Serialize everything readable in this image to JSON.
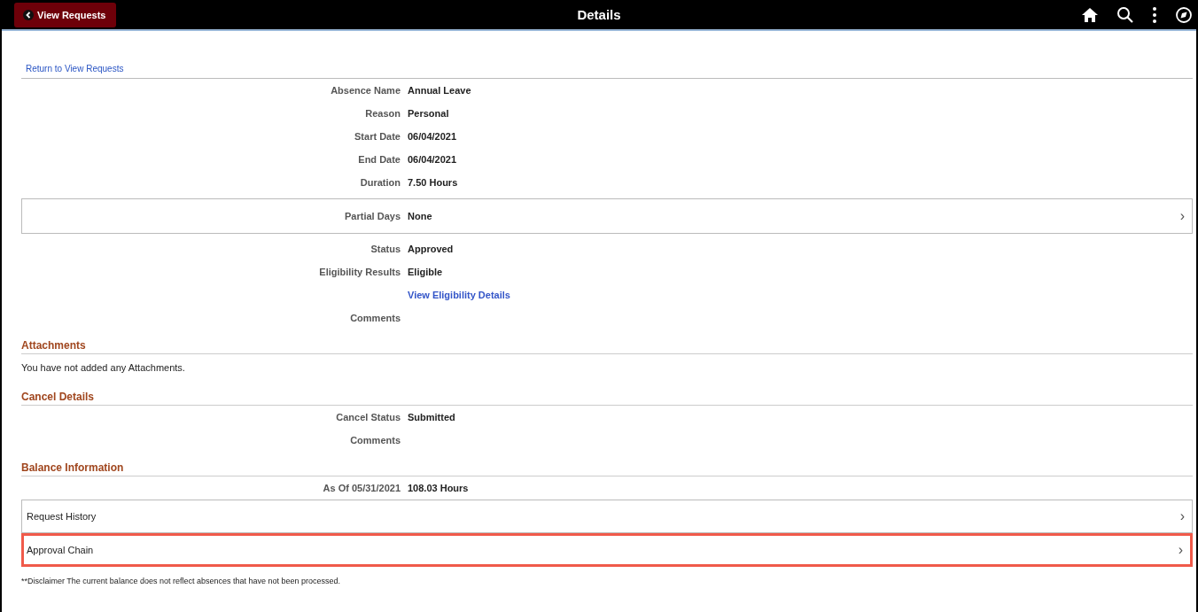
{
  "header": {
    "back_button": "View Requests",
    "title": "Details"
  },
  "return_link": "Return to View Requests",
  "content": [
    {
      "kind": "field",
      "label": "Absence Name",
      "value": "Annual Leave"
    },
    {
      "kind": "field",
      "label": "Reason",
      "value": "Personal"
    },
    {
      "kind": "field",
      "label": "Start Date",
      "value": "06/04/2021"
    },
    {
      "kind": "field",
      "label": "End Date",
      "value": "06/04/2021"
    },
    {
      "kind": "field",
      "label": "Duration",
      "value": "7.50 Hours"
    },
    {
      "kind": "nav-field",
      "label": "Partial Days",
      "value": "None",
      "chevron": "›"
    },
    {
      "kind": "field",
      "label": "Status",
      "value": "Approved"
    },
    {
      "kind": "field",
      "label": "Eligibility Results",
      "value": "Eligible"
    },
    {
      "kind": "link",
      "value": "View Eligibility Details"
    },
    {
      "kind": "field",
      "label": "Comments"
    },
    {
      "kind": "heading",
      "value": "Attachments"
    },
    {
      "kind": "text",
      "value": "You have not added any Attachments."
    },
    {
      "kind": "heading",
      "value": "Cancel Details"
    },
    {
      "kind": "field",
      "label": "Cancel Status",
      "value": "Submitted"
    },
    {
      "kind": "field",
      "label": "Comments"
    },
    {
      "kind": "heading",
      "value": "Balance Information"
    },
    {
      "kind": "field",
      "label": "As Of 05/31/2021",
      "value": "108.03 Hours"
    },
    {
      "kind": "nav",
      "label": "Request History",
      "chevron": "›",
      "highlighted": false
    },
    {
      "kind": "nav",
      "label": "Approval Chain",
      "chevron": "›",
      "highlighted": true
    },
    {
      "kind": "note",
      "value": "**Disclaimer  The current balance does not reflect absences that have not been processed."
    }
  ]
}
